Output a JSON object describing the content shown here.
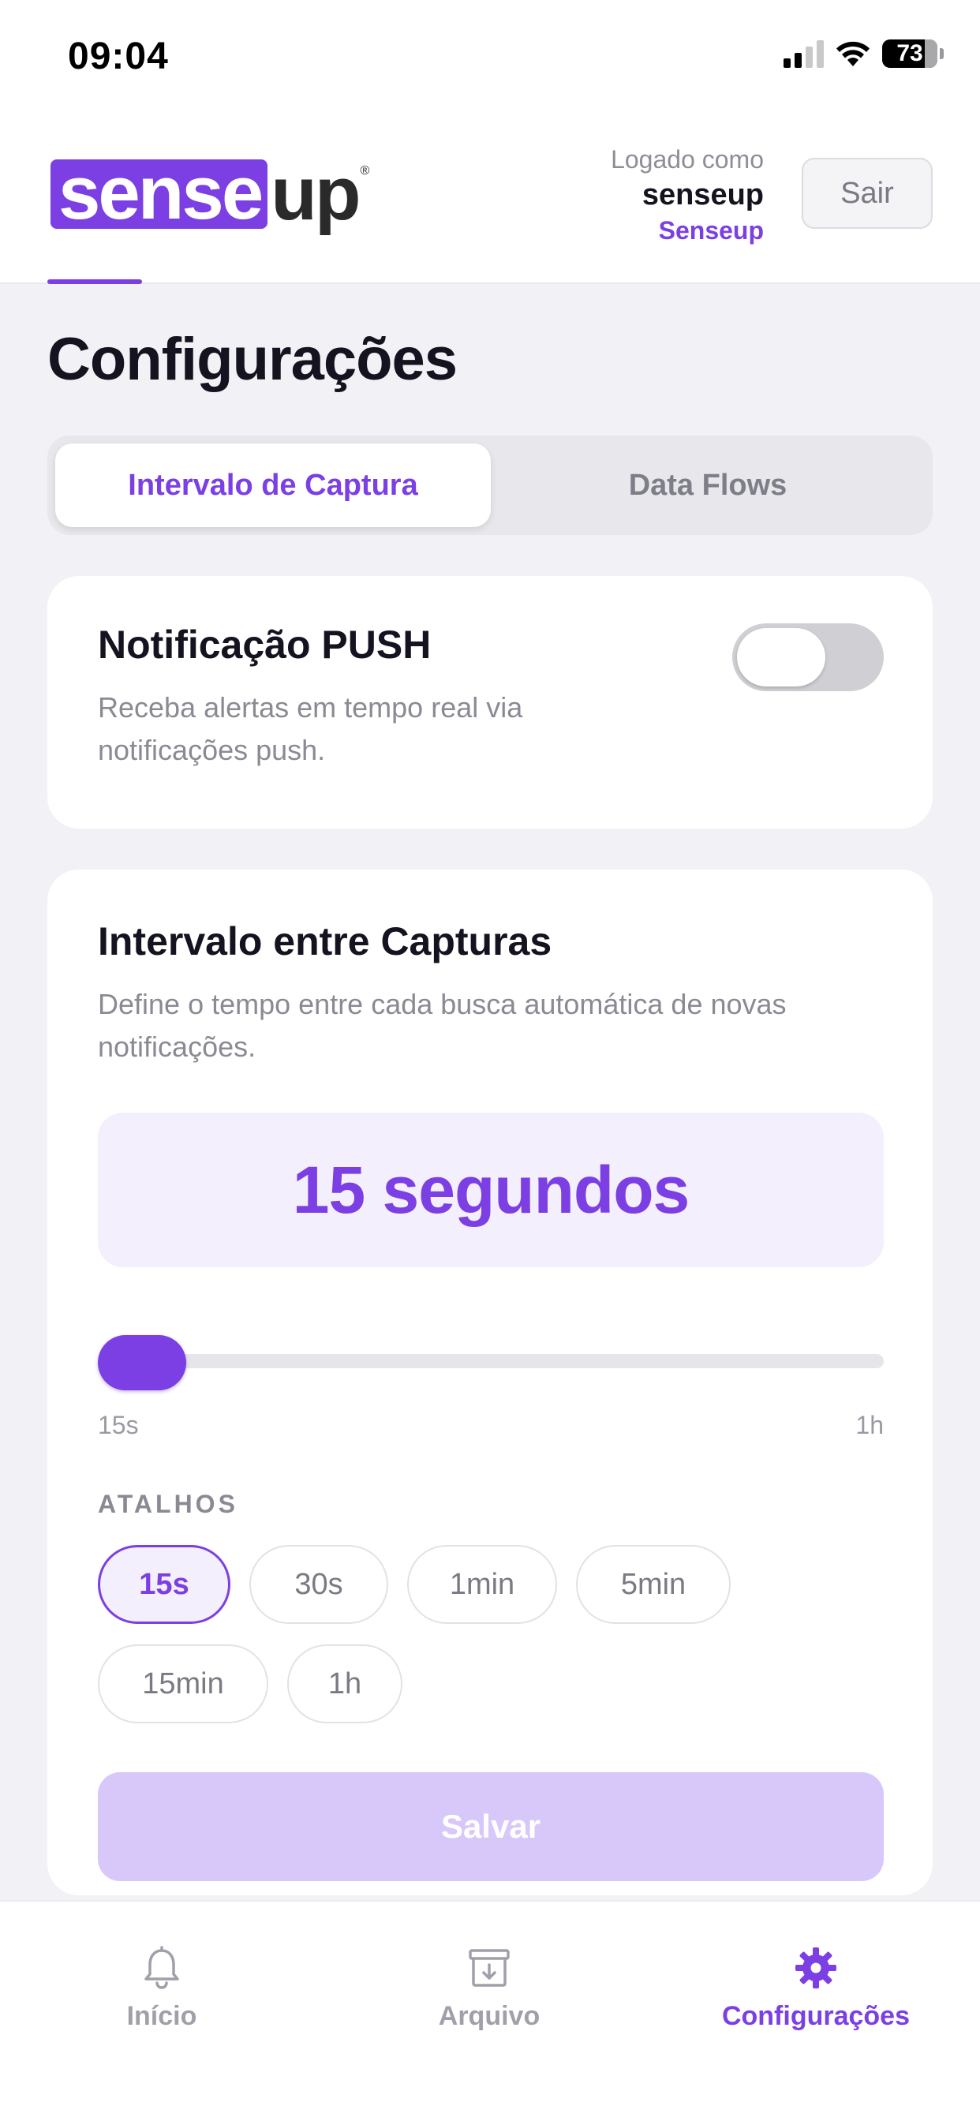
{
  "status_bar": {
    "time": "09:04",
    "battery": "73"
  },
  "header": {
    "logo_part1": "sense",
    "logo_part2": "up",
    "logo_reg": "®",
    "logged_label": "Logado como",
    "username": "senseup",
    "org": "Senseup",
    "logout_label": "Sair"
  },
  "page": {
    "title": "Configurações",
    "tabs": [
      {
        "label": "Intervalo de Captura",
        "active": true
      },
      {
        "label": "Data Flows",
        "active": false
      }
    ]
  },
  "push_card": {
    "title": "Notificação PUSH",
    "description": "Receba alertas em tempo real via notificações push.",
    "enabled": false
  },
  "interval_card": {
    "title": "Intervalo entre Capturas",
    "description": "Define o tempo entre cada busca automática de novas notificações.",
    "value_display": "15 segundos",
    "slider": {
      "min_label": "15s",
      "max_label": "1h",
      "position": 0
    },
    "shortcuts_label": "ATALHOS",
    "shortcuts": [
      {
        "label": "15s",
        "active": true
      },
      {
        "label": "30s",
        "active": false
      },
      {
        "label": "1min",
        "active": false
      },
      {
        "label": "5min",
        "active": false
      },
      {
        "label": "15min",
        "active": false
      },
      {
        "label": "1h",
        "active": false
      }
    ],
    "save_label": "Salvar"
  },
  "tab_bar": {
    "items": [
      {
        "label": "Início",
        "icon": "bell-icon",
        "active": false
      },
      {
        "label": "Arquivo",
        "icon": "archive-icon",
        "active": false
      },
      {
        "label": "Configurações",
        "icon": "gear-icon",
        "active": true
      }
    ]
  },
  "colors": {
    "accent": "#7b3fe4",
    "accent_light": "#f3effc",
    "save_disabled": "#d8c8fa",
    "background": "#f2f2f6"
  }
}
